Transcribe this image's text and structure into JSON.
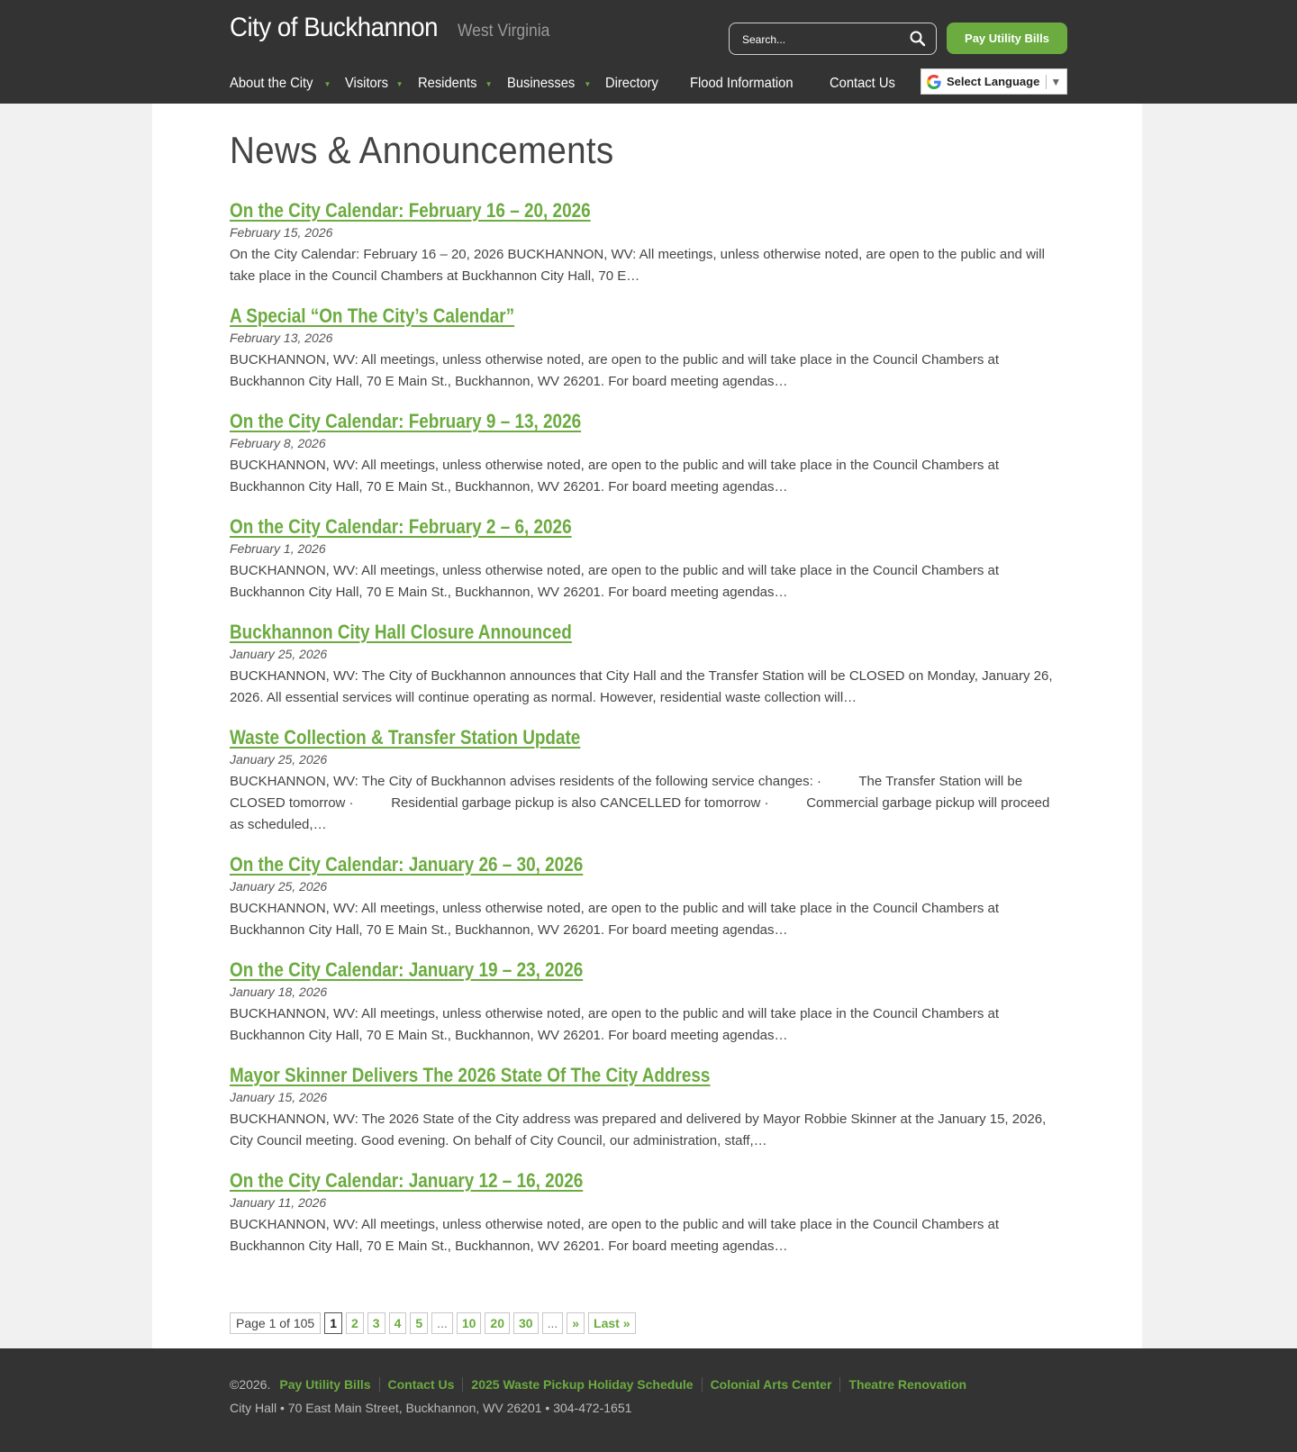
{
  "header": {
    "title": "City of Buckhannon",
    "subtitle": "West Virginia",
    "search_placeholder": "Search...",
    "pay_button": "Pay Utility Bills",
    "nav": [
      {
        "label": "About the City",
        "has_submenu": true
      },
      {
        "label": "Visitors",
        "has_submenu": true
      },
      {
        "label": "Residents",
        "has_submenu": true
      },
      {
        "label": "Businesses",
        "has_submenu": true
      },
      {
        "label": "Directory",
        "has_submenu": false
      },
      {
        "label": "Flood Information",
        "has_submenu": false
      },
      {
        "label": "Contact Us",
        "has_submenu": false
      }
    ],
    "language_label": "Select Language",
    "language_arrow": "▼"
  },
  "main": {
    "page_title": "News & Announcements",
    "posts": [
      {
        "title": "On the City Calendar: February 16 – 20, 2026",
        "date": "February 15, 2026",
        "excerpt": "On the City Calendar: February 16 – 20, 2026 BUCKHANNON, WV: All meetings, unless otherwise noted, are open to the public and will take place in the Council Chambers at Buckhannon City Hall, 70 E…"
      },
      {
        "title": "A Special “On The City’s Calendar”",
        "date": "February 13, 2026",
        "excerpt": "BUCKHANNON, WV: All meetings, unless otherwise noted, are open to the public and will take place in the Council Chambers at Buckhannon City Hall, 70 E Main St., Buckhannon, WV 26201. For board meeting agendas…"
      },
      {
        "title": "On the City Calendar: February 9 – 13, 2026",
        "date": "February 8, 2026",
        "excerpt": "BUCKHANNON, WV: All meetings, unless otherwise noted, are open to the public and will take place in the Council Chambers at Buckhannon City Hall, 70 E Main St., Buckhannon, WV 26201. For board meeting agendas…"
      },
      {
        "title": "On the City Calendar: February 2 – 6, 2026",
        "date": "February 1, 2026",
        "excerpt": "BUCKHANNON, WV: All meetings, unless otherwise noted, are open to the public and will take place in the Council Chambers at Buckhannon City Hall, 70 E Main St., Buckhannon, WV 26201. For board meeting agendas…"
      },
      {
        "title": "Buckhannon City Hall Closure Announced",
        "date": "January 25, 2026",
        "excerpt": "BUCKHANNON, WV: The City of Buckhannon announces that City Hall and the Transfer Station will be CLOSED on Monday, January 26, 2026. All essential services will continue operating as normal. However, residential waste collection will…"
      },
      {
        "title": "Waste Collection & Transfer Station Update",
        "date": "January 25, 2026",
        "excerpt": "BUCKHANNON, WV: The City of Buckhannon advises residents of the following service changes: ·          The Transfer Station will be CLOSED tomorrow ·          Residential garbage pickup is also CANCELLED for tomorrow ·          Commercial garbage pickup will proceed as scheduled,…"
      },
      {
        "title": "On the City Calendar: January 26 – 30, 2026",
        "date": "January 25, 2026",
        "excerpt": "BUCKHANNON, WV: All meetings, unless otherwise noted, are open to the public and will take place in the Council Chambers at Buckhannon City Hall, 70 E Main St., Buckhannon, WV 26201. For board meeting agendas…"
      },
      {
        "title": "On the City Calendar: January 19 – 23, 2026",
        "date": "January 18, 2026",
        "excerpt": "BUCKHANNON, WV: All meetings, unless otherwise noted, are open to the public and will take place in the Council Chambers at Buckhannon City Hall, 70 E Main St., Buckhannon, WV 26201. For board meeting agendas…"
      },
      {
        "title": "Mayor Skinner Delivers The 2026 State Of The City Address",
        "date": "January 15, 2026",
        "excerpt": "BUCKHANNON, WV: The 2026 State of the City address was prepared and delivered by Mayor Robbie Skinner at the January 15, 2026, City Council meeting. Good evening. On behalf of City Council, our administration, staff,…"
      },
      {
        "title": "On the City Calendar: January 12 – 16, 2026",
        "date": "January 11, 2026",
        "excerpt": "BUCKHANNON, WV: All meetings, unless otherwise noted, are open to the public and will take place in the Council Chambers at Buckhannon City Hall, 70 E Main St., Buckhannon, WV 26201. For board meeting agendas…"
      }
    ],
    "pagination": {
      "info": "Page 1 of 105",
      "items": [
        {
          "label": "1",
          "kind": "current"
        },
        {
          "label": "2",
          "kind": "link"
        },
        {
          "label": "3",
          "kind": "link"
        },
        {
          "label": "4",
          "kind": "link"
        },
        {
          "label": "5",
          "kind": "link"
        },
        {
          "label": "...",
          "kind": "dots"
        },
        {
          "label": "10",
          "kind": "link"
        },
        {
          "label": "20",
          "kind": "link"
        },
        {
          "label": "30",
          "kind": "link"
        },
        {
          "label": "...",
          "kind": "dots"
        },
        {
          "label": "»",
          "kind": "link"
        },
        {
          "label": "Last »",
          "kind": "link"
        }
      ]
    }
  },
  "footer": {
    "copyright": "©2026.",
    "links": [
      "Pay Utility Bills",
      "Contact Us",
      "2025 Waste Pickup Holiday Schedule",
      "Colonial Arts Center",
      "Theatre Renovation"
    ],
    "address": "City Hall • 70 East Main Street, Buckhannon, WV 26201 • 304-472-1651"
  },
  "colors": {
    "accent": "#6bab3f",
    "header_bg": "#333333",
    "page_bg": "#f1f1f1"
  }
}
